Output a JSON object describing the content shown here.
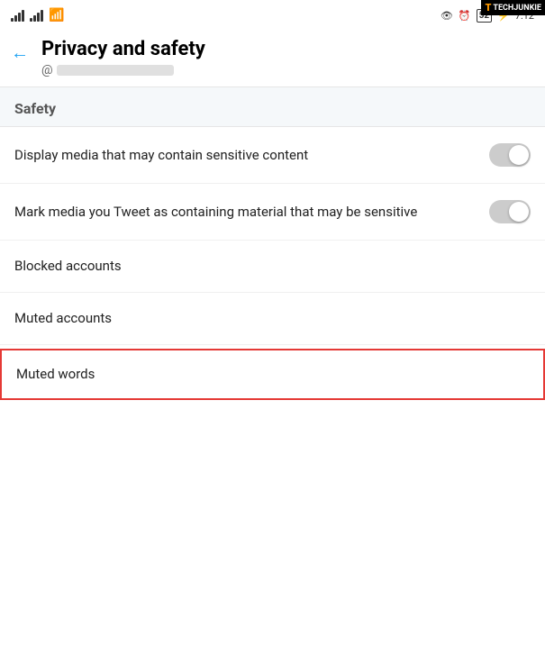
{
  "techjunkie": {
    "t": "T",
    "label": "TECHJUNKIE"
  },
  "status_bar": {
    "time": "7:12",
    "battery": "52"
  },
  "header": {
    "title": "Privacy and safety",
    "back_label": "←",
    "at_symbol": "@"
  },
  "section": {
    "title": "Safety"
  },
  "settings": [
    {
      "id": "display-media",
      "text": "Display media that may contain sensitive content",
      "has_toggle": true,
      "toggle_on": false
    },
    {
      "id": "mark-media",
      "text": "Mark media you Tweet as containing material that may be sensitive",
      "has_toggle": true,
      "toggle_on": false
    },
    {
      "id": "blocked-accounts",
      "text": "Blocked accounts",
      "has_toggle": false
    },
    {
      "id": "muted-accounts",
      "text": "Muted accounts",
      "has_toggle": false
    },
    {
      "id": "muted-words",
      "text": "Muted words",
      "has_toggle": false,
      "highlighted": true
    }
  ]
}
